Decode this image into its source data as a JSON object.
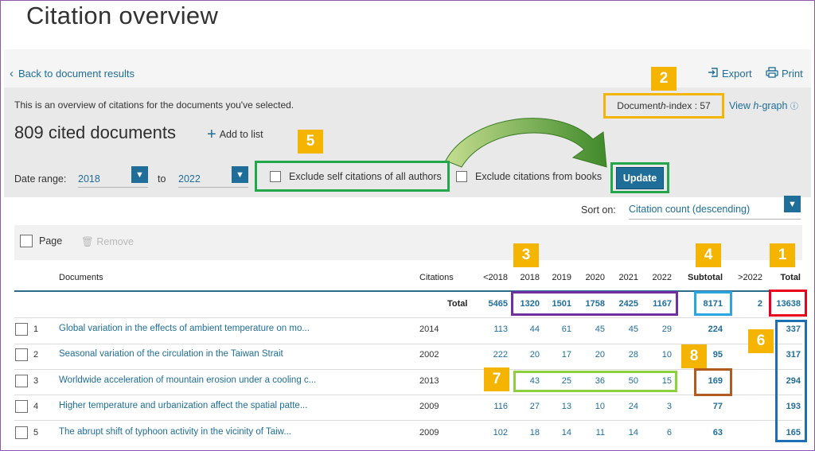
{
  "title": "Citation overview",
  "nav": {
    "back_label": "Back to document results",
    "export_label": "Export",
    "print_label": "Print"
  },
  "summary": {
    "overview_text": "This is an overview of citations for the documents you've selected.",
    "hindex_label": "Document h-index : 57",
    "view_hgraph_label": "View h-graph",
    "cited_count_text": "809 cited documents",
    "add_to_list_label": "Add to list"
  },
  "filters": {
    "date_range_label": "Date range:",
    "from_year": "2018",
    "to_label": "to",
    "to_year": "2022",
    "exclude_self_label": "Exclude self citations of all authors",
    "exclude_books_label": "Exclude citations from books",
    "update_label": "Update"
  },
  "sort": {
    "label": "Sort on:",
    "value": "Citation count (descending)"
  },
  "toolbar": {
    "page_label": "Page",
    "remove_label": "Remove"
  },
  "badges": [
    "1",
    "2",
    "3",
    "4",
    "5",
    "6",
    "7",
    "8"
  ],
  "table": {
    "headers": {
      "documents": "Documents",
      "citations": "Citations",
      "pre": "<2018",
      "y2018": "2018",
      "y2019": "2019",
      "y2020": "2020",
      "y2021": "2021",
      "y2022": "2022",
      "subtotal": "Subtotal",
      "post": ">2022",
      "total": "Total"
    },
    "total_row": {
      "label": "Total",
      "pre": "5465",
      "y2018": "1320",
      "y2019": "1501",
      "y2020": "1758",
      "y2021": "2425",
      "y2022": "1167",
      "subtotal": "8171",
      "post": "2",
      "total": "13638"
    },
    "rows": [
      {
        "num": "1",
        "title": "Global variation in the effects of ambient temperature on mo...",
        "year": "2014",
        "pre": "113",
        "y2018": "44",
        "y2019": "61",
        "y2020": "45",
        "y2021": "45",
        "y2022": "29",
        "subtotal": "224",
        "post": "",
        "total": "337"
      },
      {
        "num": "2",
        "title": "Seasonal variation of the circulation in the Taiwan Strait",
        "year": "2002",
        "pre": "222",
        "y2018": "20",
        "y2019": "17",
        "y2020": "20",
        "y2021": "28",
        "y2022": "10",
        "subtotal": "95",
        "post": "",
        "total": "317"
      },
      {
        "num": "3",
        "title": "Worldwide acceleration of mountain erosion under a cooling c...",
        "year": "2013",
        "pre": "",
        "y2018": "43",
        "y2019": "25",
        "y2020": "36",
        "y2021": "50",
        "y2022": "15",
        "subtotal": "169",
        "post": "",
        "total": "294"
      },
      {
        "num": "4",
        "title": "Higher temperature and urbanization affect the spatial patte...",
        "year": "2009",
        "pre": "116",
        "y2018": "27",
        "y2019": "13",
        "y2020": "10",
        "y2021": "24",
        "y2022": "3",
        "subtotal": "77",
        "post": "",
        "total": "193"
      },
      {
        "num": "5",
        "title": "The abrupt shift of typhoon activity in the vicinity of Taiw...",
        "year": "2009",
        "pre": "102",
        "y2018": "18",
        "y2019": "14",
        "y2020": "11",
        "y2021": "14",
        "y2022": "6",
        "subtotal": "63",
        "post": "",
        "total": "165"
      }
    ]
  },
  "colors": {
    "accent": "#1f6d99",
    "badge": "#f4b400",
    "green": "#22a84a",
    "purple": "#7030a0",
    "light_blue": "#2aa7e0",
    "red": "#e8001c",
    "blue": "#1a6fb5",
    "lime": "#8ccf3f",
    "brown": "#b35a1f"
  }
}
